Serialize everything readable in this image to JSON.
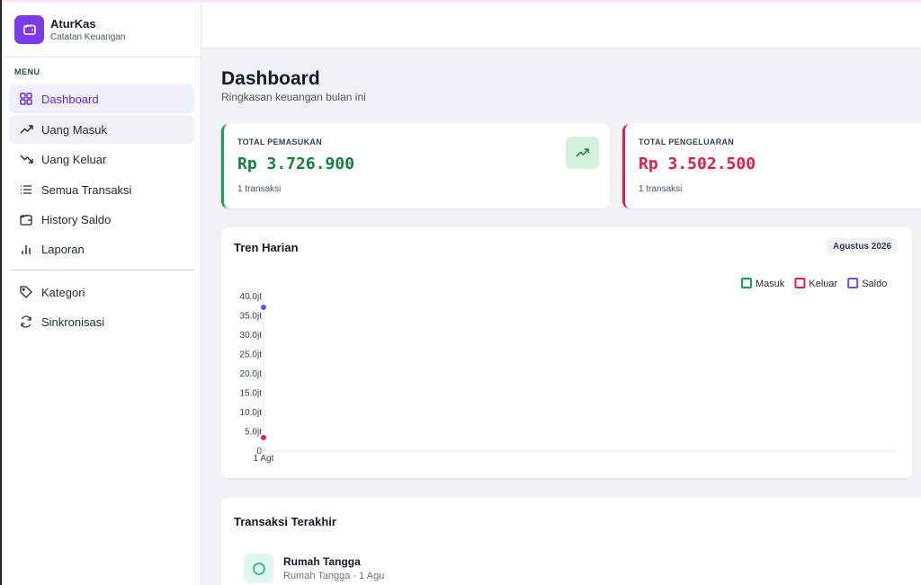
{
  "brand": {
    "name": "AturKas",
    "subtitle": "Catatan Keuangan",
    "logo_icon": "wallet-icon",
    "accent": "#7c3aed"
  },
  "sidebar": {
    "menu_label": "MENU",
    "items": [
      {
        "label": "Dashboard",
        "icon": "grid-icon",
        "active": true
      },
      {
        "label": "Uang Masuk",
        "icon": "trend-up-icon"
      },
      {
        "label": "Uang Keluar",
        "icon": "trend-down-icon"
      },
      {
        "label": "Semua Transaksi",
        "icon": "list-icon"
      },
      {
        "label": "History Saldo",
        "icon": "wallet-icon"
      },
      {
        "label": "Laporan",
        "icon": "bar-chart-icon"
      },
      {
        "label": "Kategori",
        "icon": "tag-icon"
      },
      {
        "label": "Sinkronisasi",
        "icon": "sync-icon"
      }
    ]
  },
  "page": {
    "title": "Dashboard",
    "subtitle": "Ringkasan keuangan bulan ini"
  },
  "stats": {
    "income": {
      "label": "TOTAL PEMASUKAN",
      "value": "Rp 3.726.900",
      "count": "1 transaksi",
      "color": "#15803d",
      "icon": "trend-up-icon"
    },
    "expense": {
      "label": "TOTAL PENGELUARAN",
      "value": "Rp 3.502.500",
      "count": "1 transaksi",
      "color": "#e11d48"
    }
  },
  "trend": {
    "title": "Tren Harian",
    "period": "Agustus 2026"
  },
  "chart_data": {
    "type": "line",
    "title": "Tren Harian",
    "x": [
      "1 Agt"
    ],
    "series": [
      {
        "name": "Masuk",
        "color": "#16a34a",
        "values": [
          3.7269
        ]
      },
      {
        "name": "Keluar",
        "color": "#e11d48",
        "values": [
          3.5025
        ]
      },
      {
        "name": "Saldo",
        "color": "#6d4ef5",
        "values": [
          37.2
        ]
      }
    ],
    "yticks": [
      "0",
      "5.0jt",
      "10.0jt",
      "15.0jt",
      "20.0jt",
      "25.0jt",
      "30.0jt",
      "35.0jt",
      "40.0jt"
    ],
    "ylim": [
      0,
      40
    ],
    "legend": "top-right",
    "grid": false
  },
  "recent": {
    "title": "Transaksi Terakhir",
    "items": [
      {
        "name": "Rumah Tangga",
        "meta": "Rumah Tangga · 1 Agu",
        "icon": "circle-icon"
      }
    ]
  }
}
